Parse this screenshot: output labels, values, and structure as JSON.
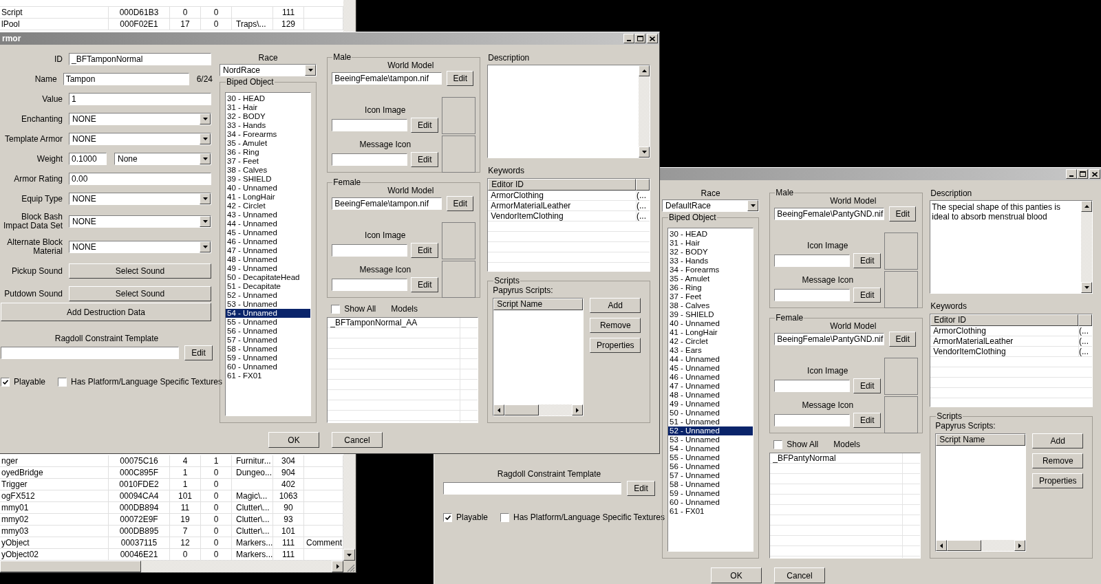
{
  "list_window": {
    "top_rows": [
      {
        "column_1": "Script",
        "column_2": "000D61B3",
        "column_3": "0",
        "column_4": "0",
        "column_6": "111"
      },
      {
        "column_1": "lPool",
        "column_2": "000F02E1",
        "column_3": "17",
        "column_4": "0",
        "column_5": "Traps\\...",
        "column_6": "129"
      }
    ],
    "bottom_rows": [
      {
        "column_1": "nger",
        "column_2": "00075C16",
        "column_3": "4",
        "column_4": "1",
        "column_5": "Furnitur...",
        "column_6": "304"
      },
      {
        "column_1": "oyedBridge",
        "column_2": "000C895F",
        "column_3": "1",
        "column_4": "0",
        "column_5": "Dungeo...",
        "column_6": "904"
      },
      {
        "column_1": "Trigger",
        "column_2": "0010FDE2",
        "column_3": "1",
        "column_4": "0",
        "column_6": "402"
      },
      {
        "column_1": "ogFX512",
        "column_2": "00094CA4",
        "column_3": "101",
        "column_4": "0",
        "column_5": "Magic\\...",
        "column_6": "1063"
      },
      {
        "column_1": "mmy01",
        "column_2": "000DB894",
        "column_3": "11",
        "column_4": "0",
        "column_5": "Clutter\\...",
        "column_6": "90"
      },
      {
        "column_1": "mmy02",
        "column_2": "00072E9F",
        "column_3": "19",
        "column_4": "0",
        "column_5": "Clutter\\...",
        "column_6": "93"
      },
      {
        "column_1": "mmy03",
        "column_2": "000DB895",
        "column_3": "7",
        "column_4": "0",
        "column_5": "Clutter\\...",
        "column_6": "101"
      },
      {
        "column_1": "yObject",
        "column_2": "00037115",
        "column_3": "12",
        "column_4": "0",
        "column_5": "Markers...",
        "column_6": "111",
        "column_7": "Comment"
      },
      {
        "column_1": "yObject02",
        "column_2": "00046E21",
        "column_3": "0",
        "column_4": "0",
        "column_5": "Markers...",
        "column_6": "111"
      }
    ]
  },
  "dialogs": [
    {
      "title": "rmor",
      "fields": [
        {
          "kind": "text",
          "label": "ID",
          "value": "_BFTamponNormal"
        },
        {
          "kind": "text",
          "label": "Name",
          "value": "Tampon",
          "counter": "6/24"
        },
        {
          "kind": "text",
          "label": "Value",
          "value": "1"
        },
        {
          "kind": "dropdown",
          "label": "Enchanting",
          "value": "NONE"
        },
        {
          "kind": "dropdown",
          "label": "Template Armor",
          "value": "NONE"
        },
        {
          "kind": "number_unit",
          "label": "Weight",
          "value": "0.1000",
          "unit": "None"
        },
        {
          "kind": "text",
          "label": "Armor Rating",
          "value": "0.00"
        },
        {
          "kind": "dropdown",
          "label": "Equip Type",
          "value": "NONE"
        },
        {
          "kind": "dropdown",
          "label": "Block Bash Impact Data Set",
          "value": "NONE"
        },
        {
          "kind": "dropdown",
          "label": "Alternate Block Material",
          "value": "NONE"
        },
        {
          "kind": "button",
          "label": "Pickup Sound",
          "value": "Select Sound"
        },
        {
          "kind": "button",
          "label": "Putdown Sound",
          "value": "Select Sound"
        }
      ],
      "destruction_button": "Add Destruction Data",
      "ragdoll": {
        "label": "Ragdoll Constraint Template",
        "button": "Edit"
      },
      "checkboxes": [
        {
          "label": "Playable",
          "checked": true
        },
        {
          "label": "Has Platform/Language Specific Textures",
          "checked": false
        }
      ],
      "race": {
        "label": "Race",
        "value": "NordRace"
      },
      "biped": {
        "label": "Biped Object",
        "items": [
          {
            "label": "30 - HEAD",
            "selected": false
          },
          {
            "label": "31 - Hair",
            "selected": false
          },
          {
            "label": "32 - BODY",
            "selected": false
          },
          {
            "label": "33 - Hands",
            "selected": false
          },
          {
            "label": "34 - Forearms",
            "selected": false
          },
          {
            "label": "35 - Amulet",
            "selected": false
          },
          {
            "label": "36 - Ring",
            "selected": false
          },
          {
            "label": "37 - Feet",
            "selected": false
          },
          {
            "label": "38 - Calves",
            "selected": false
          },
          {
            "label": "39 - SHIELD",
            "selected": false
          },
          {
            "label": "40 - Unnamed",
            "selected": false
          },
          {
            "label": "41 - LongHair",
            "selected": false
          },
          {
            "label": "42 - Circlet",
            "selected": false
          },
          {
            "label": "43 - Unnamed",
            "selected": false
          },
          {
            "label": "44 - Unnamed",
            "selected": false
          },
          {
            "label": "45 - Unnamed",
            "selected": false
          },
          {
            "label": "46 - Unnamed",
            "selected": false
          },
          {
            "label": "47 - Unnamed",
            "selected": false
          },
          {
            "label": "48 - Unnamed",
            "selected": false
          },
          {
            "label": "49 - Unnamed",
            "selected": false
          },
          {
            "label": "50 - DecapitateHead",
            "selected": false
          },
          {
            "label": "51 - Decapitate",
            "selected": false
          },
          {
            "label": "52 - Unnamed",
            "selected": false
          },
          {
            "label": "53 - Unnamed",
            "selected": false
          },
          {
            "label": "54 - Unnamed",
            "selected": true
          },
          {
            "label": "55 - Unnamed",
            "selected": false
          },
          {
            "label": "56 - Unnamed",
            "selected": false
          },
          {
            "label": "57 - Unnamed",
            "selected": false
          },
          {
            "label": "58 - Unnamed",
            "selected": false
          },
          {
            "label": "59 - Unnamed",
            "selected": false
          },
          {
            "label": "60 - Unnamed",
            "selected": false
          },
          {
            "label": "61 - FX01",
            "selected": false
          }
        ]
      },
      "model_groups": [
        {
          "label": "Male",
          "world_model_label": "World Model",
          "world_model": "BeeingFemale\\tampon.nif",
          "world_button": "Edit",
          "icon_label": "Icon Image",
          "icon_button": "Edit",
          "message_label": "Message Icon",
          "message_button": "Edit"
        },
        {
          "label": "Female",
          "world_model_label": "World Model",
          "world_model": "BeeingFemale\\tampon.nif",
          "world_button": "Edit",
          "icon_label": "Icon Image",
          "icon_button": "Edit",
          "message_label": "Message Icon",
          "message_button": "Edit"
        }
      ],
      "show_all": {
        "label": "Show All",
        "checked": false
      },
      "models": {
        "label": "Models",
        "items": [
          "_BFTamponNormal_AA"
        ]
      },
      "description": {
        "label": "Description"
      },
      "keywords": {
        "label": "Keywords",
        "header": "Editor ID",
        "rows": [
          {
            "name": "ArmorClothing",
            "column_2": "(..."
          },
          {
            "name": "ArmorMaterialLeather",
            "column_2": "(..."
          },
          {
            "name": "VendorItemClothing",
            "column_2": "(..."
          }
        ]
      },
      "scripts": {
        "label": "Scripts",
        "sublabel": "Papyrus Scripts:",
        "header": "Script Name",
        "buttons": [
          "Add",
          "Remove",
          "Properties"
        ]
      },
      "buttons": [
        "OK",
        "Cancel"
      ]
    },
    {
      "ragdoll": {
        "label": "Ragdoll Constraint Template",
        "button": "Edit"
      },
      "checkboxes": [
        {
          "label": "Playable",
          "checked": true
        },
        {
          "label": "Has Platform/Language Specific Textures",
          "checked": false
        }
      ],
      "race": {
        "label": "Race",
        "value": "DefaultRace"
      },
      "biped": {
        "label": "Biped Object",
        "items": [
          {
            "label": "30 - HEAD",
            "selected": false
          },
          {
            "label": "31 - Hair",
            "selected": false
          },
          {
            "label": "32 - BODY",
            "selected": false
          },
          {
            "label": "33 - Hands",
            "selected": false
          },
          {
            "label": "34 - Forearms",
            "selected": false
          },
          {
            "label": "35 - Amulet",
            "selected": false
          },
          {
            "label": "36 - Ring",
            "selected": false
          },
          {
            "label": "37 - Feet",
            "selected": false
          },
          {
            "label": "38 - Calves",
            "selected": false
          },
          {
            "label": "39 - SHIELD",
            "selected": false
          },
          {
            "label": "40 - Unnamed",
            "selected": false
          },
          {
            "label": "41 - LongHair",
            "selected": false
          },
          {
            "label": "42 - Circlet",
            "selected": false
          },
          {
            "label": "43 - Ears",
            "selected": false
          },
          {
            "label": "44 - Unnamed",
            "selected": false
          },
          {
            "label": "45 - Unnamed",
            "selected": false
          },
          {
            "label": "46 - Unnamed",
            "selected": false
          },
          {
            "label": "47 - Unnamed",
            "selected": false
          },
          {
            "label": "48 - Unnamed",
            "selected": false
          },
          {
            "label": "49 - Unnamed",
            "selected": false
          },
          {
            "label": "50 - Unnamed",
            "selected": false
          },
          {
            "label": "51 - Unnamed",
            "selected": false
          },
          {
            "label": "52 - Unnamed",
            "selected": true
          },
          {
            "label": "53 - Unnamed",
            "selected": false
          },
          {
            "label": "54 - Unnamed",
            "selected": false
          },
          {
            "label": "55 - Unnamed",
            "selected": false
          },
          {
            "label": "56 - Unnamed",
            "selected": false
          },
          {
            "label": "57 - Unnamed",
            "selected": false
          },
          {
            "label": "58 - Unnamed",
            "selected": false
          },
          {
            "label": "59 - Unnamed",
            "selected": false
          },
          {
            "label": "60 - Unnamed",
            "selected": false
          },
          {
            "label": "61 - FX01",
            "selected": false
          }
        ]
      },
      "model_groups": [
        {
          "label": "Male",
          "world_model_label": "World Model",
          "world_model": "BeeingFemale\\PantyGND.nif",
          "world_button": "Edit",
          "icon_label": "Icon Image",
          "icon_button": "Edit",
          "message_label": "Message Icon",
          "message_button": "Edit"
        },
        {
          "label": "Female",
          "world_model_label": "World Model",
          "world_model": "BeeingFemale\\PantyGND.nif",
          "world_button": "Edit",
          "icon_label": "Icon Image",
          "icon_button": "Edit",
          "message_label": "Message Icon",
          "message_button": "Edit"
        }
      ],
      "show_all": {
        "label": "Show All",
        "checked": false
      },
      "models": {
        "label": "Models",
        "items": [
          "_BFPantyNormal"
        ]
      },
      "description": {
        "label": "Description",
        "text": "The special shape of this panties is ideal to absorb menstrual blood"
      },
      "keywords": {
        "label": "Keywords",
        "header": "Editor ID",
        "rows": [
          {
            "name": "ArmorClothing",
            "column_2": "(..."
          },
          {
            "name": "ArmorMaterialLeather",
            "column_2": "(..."
          },
          {
            "name": "VendorItemClothing",
            "column_2": "(..."
          }
        ]
      },
      "scripts": {
        "label": "Scripts",
        "sublabel": "Papyrus Scripts:",
        "header": "Script Name",
        "buttons": [
          "Add",
          "Remove",
          "Properties"
        ]
      },
      "buttons": [
        "OK",
        "Cancel"
      ]
    }
  ]
}
